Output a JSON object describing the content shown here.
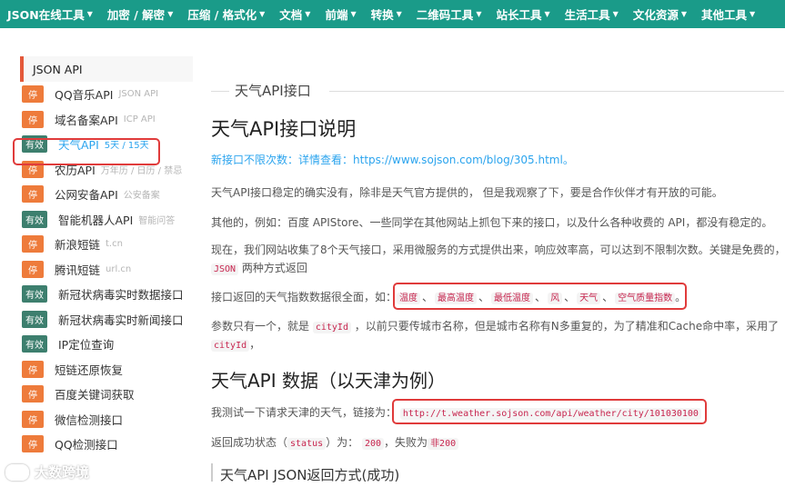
{
  "topnav": [
    {
      "label": "JSON在线工具"
    },
    {
      "label": "加密 / 解密"
    },
    {
      "label": "压缩 / 格式化"
    },
    {
      "label": "文档"
    },
    {
      "label": "前端"
    },
    {
      "label": "转换"
    },
    {
      "label": "二维码工具"
    },
    {
      "label": "站长工具"
    },
    {
      "label": "生活工具"
    },
    {
      "label": "文化资源"
    },
    {
      "label": "其他工具"
    }
  ],
  "sidebar": {
    "heading": "JSON API",
    "items": [
      {
        "badge": "停",
        "label": "QQ音乐API",
        "sub": "JSON API",
        "status": "stop"
      },
      {
        "badge": "停",
        "label": "域名备案API",
        "sub": "ICP API",
        "status": "stop"
      },
      {
        "badge": "有效",
        "label": "天气API",
        "sub": "5天 / 15天",
        "status": "ok",
        "active": true
      },
      {
        "badge": "停",
        "label": "农历API",
        "sub": "万年历 / 日历 / 禁忌",
        "status": "stop"
      },
      {
        "badge": "停",
        "label": "公网安备API",
        "sub": "公安备案",
        "status": "stop"
      },
      {
        "badge": "有效",
        "label": "智能机器人API",
        "sub": "智能问答",
        "status": "ok"
      },
      {
        "badge": "停",
        "label": "新浪短链",
        "sub": "t.cn",
        "status": "stop"
      },
      {
        "badge": "停",
        "label": "腾讯短链",
        "sub": "url.cn",
        "status": "stop"
      },
      {
        "badge": "有效",
        "label": "新冠状病毒实时数据接口",
        "sub": "",
        "status": "ok"
      },
      {
        "badge": "有效",
        "label": "新冠状病毒实时新闻接口",
        "sub": "",
        "status": "ok"
      },
      {
        "badge": "有效",
        "label": "IP定位查询",
        "sub": "",
        "status": "ok"
      },
      {
        "badge": "停",
        "label": "短链还原恢复",
        "sub": "",
        "status": "stop"
      },
      {
        "badge": "停",
        "label": "百度关键词获取",
        "sub": "",
        "status": "stop"
      },
      {
        "badge": "停",
        "label": "微信检测接口",
        "sub": "",
        "status": "stop"
      },
      {
        "badge": "停",
        "label": "QQ检测接口",
        "sub": "",
        "status": "stop"
      }
    ]
  },
  "main": {
    "tab_title": "天气API接口",
    "h1": "天气API接口说明",
    "notice_prefix": "新接口不限次数：详情查看：",
    "notice_link": "https://www.sojson.com/blog/305.html",
    "notice_suffix": "。",
    "p1": "天气API接口稳定的确实没有，除非是天气官方提供的， 但是我观察了下，要是合作伙伴才有开放的可能。",
    "p2": "其他的，例如：百度 APIStore、一些同学在其他网站上抓包下来的接口，以及什么各种收费的 API，都没有稳定的。",
    "p3a": "现在，我们网站收集了8个天气接口，采用微服务的方式提供出来，响应效率高，可以达到不限制次数。关键是免费的，",
    "p3_code": "JSON",
    "p3b": "两种方式返回",
    "p4_prefix": "接口返回的天气指数数据很全面，如：",
    "p4_codes": [
      "温度",
      "最高温度",
      "最低温度",
      "风",
      "天气",
      "空气质量指数"
    ],
    "p4_sep": "、",
    "p4_suffix": "。",
    "p5a": "参数只有一个，就是",
    "p5_code": "cityId",
    "p5b": "，以前只要传城市名称，但是城市名称有N多重复的，为了精准和Cache命中率，采用了",
    "p5_code2": "cityId",
    "p5c": "，",
    "h2": "天气API 数据（以天津为例）",
    "p6_prefix": "我测试一下请求天津的天气，链接为：",
    "p6_code": "http://t.weather.sojson.com/api/weather/city/101030100",
    "p7a": "返回成功状态（",
    "p7_code": "status",
    "p7b": "）为：",
    "p7_code2": "200",
    "p7c": "，失败为",
    "p7_fail": "非200",
    "h3": "天气API JSON返回方式(成功)"
  },
  "watermark": "大数跨境"
}
